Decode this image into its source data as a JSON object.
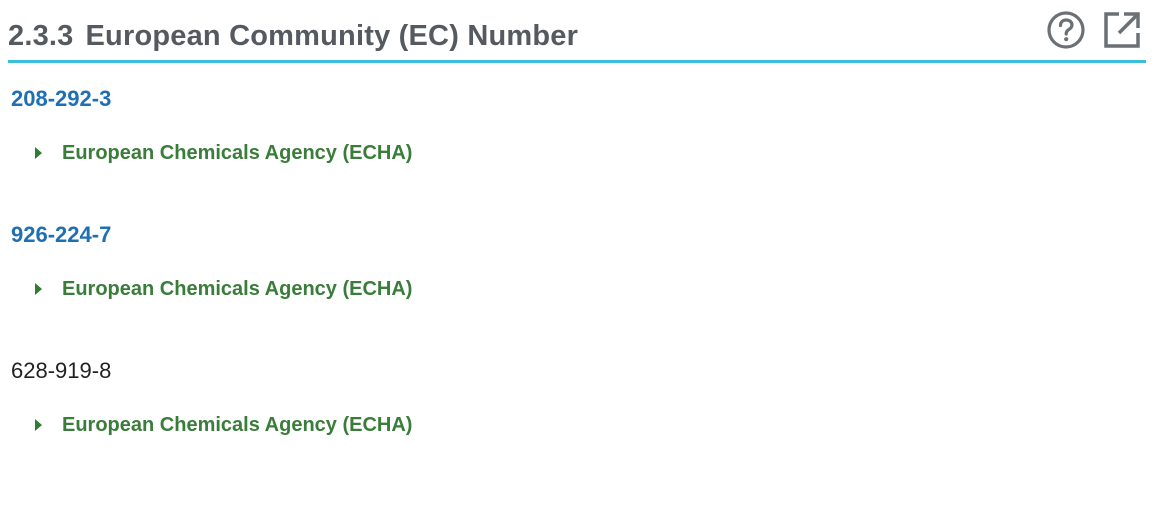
{
  "section": {
    "number": "2.3.3",
    "title": "European Community (EC) Number",
    "accent_color": "#3cbfdc",
    "icons": [
      "help-icon",
      "open-external-icon"
    ]
  },
  "entries": [
    {
      "value": "208-292-3",
      "is_link": true,
      "source": "European Chemicals Agency (ECHA)"
    },
    {
      "value": "926-224-7",
      "is_link": true,
      "source": "European Chemicals Agency (ECHA)"
    },
    {
      "value": "628-919-8",
      "is_link": false,
      "source": "European Chemicals Agency (ECHA)"
    }
  ],
  "colors": {
    "link": "#1f6fb5",
    "source": "#3a7d3a",
    "title": "#555a60",
    "plain_text": "#222222"
  }
}
